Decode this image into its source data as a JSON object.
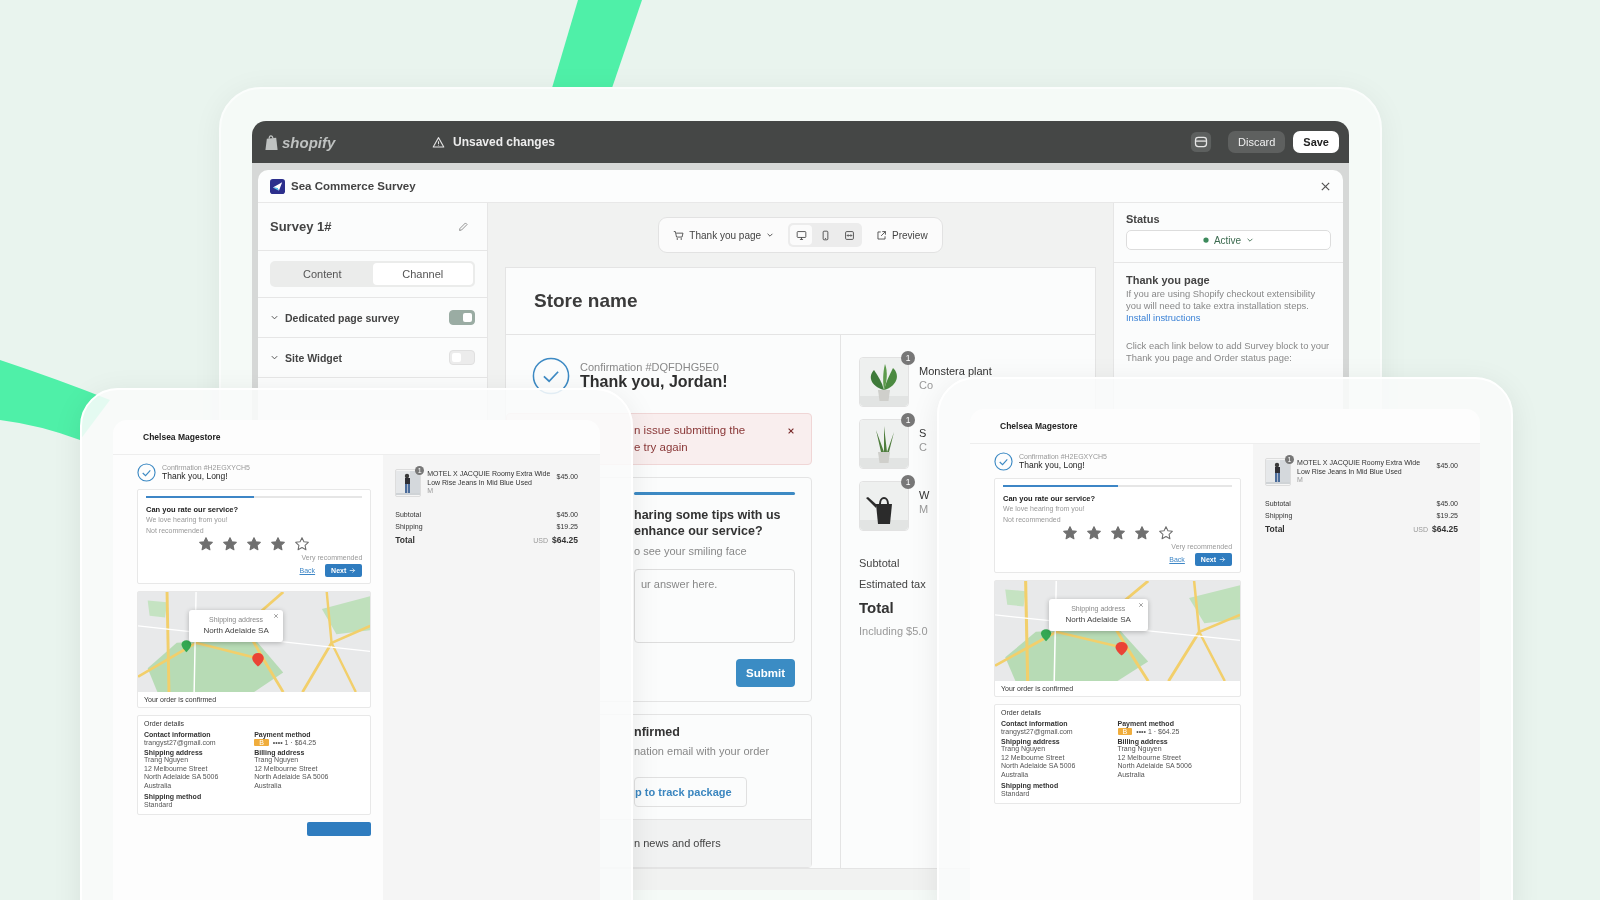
{
  "header": {
    "logo": "shopify",
    "notice": "Unsaved changes",
    "buttons": [
      {
        "label": "Discard",
        "kind": "secondary"
      },
      {
        "label": "Save",
        "kind": "primary"
      }
    ]
  },
  "app": {
    "title": "Sea Commerce Survey"
  },
  "sidebar": {
    "title": "Survey 1#",
    "tabs": [
      {
        "label": "Content",
        "selected": false
      },
      {
        "label": "Channel",
        "selected": true
      }
    ],
    "sections": [
      {
        "label": "Dedicated page survey",
        "on": true
      },
      {
        "label": "Site Widget",
        "on": false
      }
    ]
  },
  "toolbar": {
    "page": "Thank you page",
    "devices": [
      {
        "kind": "desktop",
        "selected": true
      },
      {
        "kind": "mobile",
        "selected": false
      },
      {
        "kind": "fullscreen",
        "selected": false
      }
    ],
    "preview": "Preview"
  },
  "preview": {
    "store": "Store name",
    "confirmation": "Confirmation #DQFDHG5E0",
    "thanks": "Thank you, Jordan!",
    "error": [
      "n issue submitting the",
      "e try again"
    ],
    "survey": {
      "level": 1,
      "question": [
        "haring some tips with us",
        "enhance our service?"
      ],
      "subtitle": "o see your smiling face",
      "placeholder": "ur answer here.",
      "submit": "Submit"
    },
    "confirmed": {
      "title": "nfirmed",
      "text": "nation email with your order",
      "link": "p to track package"
    },
    "news": "n news and offers",
    "items": [
      {
        "qty": "1",
        "name": "Monstera plant",
        "sub": "Co"
      },
      {
        "qty": "1",
        "name": "S",
        "sub": "C"
      },
      {
        "qty": "1",
        "name": "W",
        "sub": "M"
      }
    ],
    "subtotal": "Subtotal",
    "tax": "Estimated tax",
    "total": "Total",
    "including": "Including $5.0"
  },
  "status_panel": {
    "heading": "Status",
    "status": "Active",
    "section": "Thank you page",
    "text": "If you are using Shopify checkout extensibility you will need to take extra installation steps.",
    "link": "Install instructions",
    "note": "Click each link below to add Survey block to your Thank you page and Order status page:"
  },
  "cards": [
    {
      "store": "Chelsea Magestore",
      "confirmation": "Confirmation #H2EGXYCH5",
      "thanks": "Thank you, Long!",
      "level": 0.5,
      "question": "Can you rate our service?",
      "hint": "We love hearing from you!",
      "low": "Not recommended",
      "stars": 4,
      "high": "Very recommended",
      "back": "Back",
      "next": "Next",
      "popup_label": "Shipping address",
      "popup_value": "North Adelaide SA",
      "confirmed": "Your order is confirmed",
      "details_title": "Order details",
      "contact_label": "Contact information",
      "email": "trangyst27@gmail.com",
      "payment_label": "Payment method",
      "card_badge": "B",
      "card": "•••• 1 · $64.25",
      "shipping_label": "Shipping address",
      "shipping": [
        "Trang Nguyen",
        "12 Melbourne Street",
        "North Adelaide SA 5006",
        "Australia"
      ],
      "billing_label": "Billing address",
      "billing": [
        "Trang Nguyen",
        "12 Melbourne Street",
        "North Adelaide SA 5006",
        "Australia"
      ],
      "method_label": "Shipping method",
      "method": "Standard",
      "qty": "1",
      "product": "MOTEL X JACQUIE Roomy Extra Wide Low Rise Jeans In Mid Blue Used",
      "variant": "M",
      "price": "$45.00",
      "subtotal_label": "Subtotal",
      "subtotal": "$45.00",
      "shipping_cost_label": "Shipping",
      "shipping_cost": "$19.25",
      "total_label": "Total",
      "currency": "USD",
      "total": "$64.25",
      "more_below": true
    },
    {
      "store": "Chelsea Magestore",
      "confirmation": "Confirmation #H2EGXYCH5",
      "thanks": "Thank you, Long!",
      "level": 0.5,
      "question": "Can you rate our service?",
      "hint": "We love hearing from you!",
      "low": "Not recommended",
      "stars": 4,
      "high": "Very recommended",
      "back": "Back",
      "next": "Next",
      "popup_label": "Shipping address",
      "popup_value": "North Adelaide SA",
      "confirmed": "Your order is confirmed",
      "details_title": "Order details",
      "contact_label": "Contact information",
      "email": "trangyst27@gmail.com",
      "payment_label": "Payment method",
      "card_badge": "B",
      "card": "•••• 1 · $64.25",
      "shipping_label": "Shipping address",
      "shipping": [
        "Trang Nguyen",
        "12 Melbourne Street",
        "North Adelaide SA 5006",
        "Australia"
      ],
      "billing_label": "Billing address",
      "billing": [
        "Trang Nguyen",
        "12 Melbourne Street",
        "North Adelaide SA 5006",
        "Australia"
      ],
      "method_label": "Shipping method",
      "method": "Standard",
      "qty": "1",
      "product": "MOTEL X JACQUIE Roomy Extra Wide Low Rise Jeans In Mid Blue Used",
      "variant": "M",
      "price": "$45.00",
      "subtotal_label": "Subtotal",
      "subtotal": "$45.00",
      "shipping_cost_label": "Shipping",
      "shipping_cost": "$19.25",
      "total_label": "Total",
      "currency": "USD",
      "total": "$64.25",
      "more_below": false
    }
  ]
}
